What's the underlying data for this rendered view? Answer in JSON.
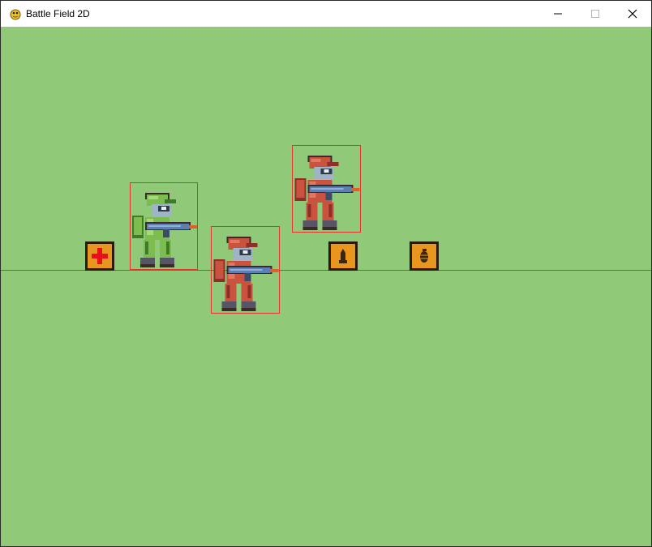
{
  "window": {
    "title": "Battle Field 2D"
  },
  "controls": {
    "minimize": "minimize-button",
    "maximize": "maximize-button",
    "close": "close-button"
  },
  "colors": {
    "grass": "#90c978",
    "hitbox": "#e8302a",
    "player_green": "#7dbd4f",
    "enemy_red": "#c9533f",
    "pickup_orange": "#e8961e",
    "gun_blue": "#5d7fb1"
  },
  "entities": {
    "player": {
      "team": "green",
      "icon": "soldier-icon"
    },
    "enemies": [
      {
        "team": "red",
        "icon": "soldier-icon"
      },
      {
        "team": "red",
        "icon": "soldier-icon"
      }
    ]
  },
  "pickups": [
    {
      "type": "health",
      "icon": "red-cross-icon"
    },
    {
      "type": "ammo",
      "icon": "bullet-icon"
    },
    {
      "type": "grenade",
      "icon": "grenade-icon"
    }
  ]
}
